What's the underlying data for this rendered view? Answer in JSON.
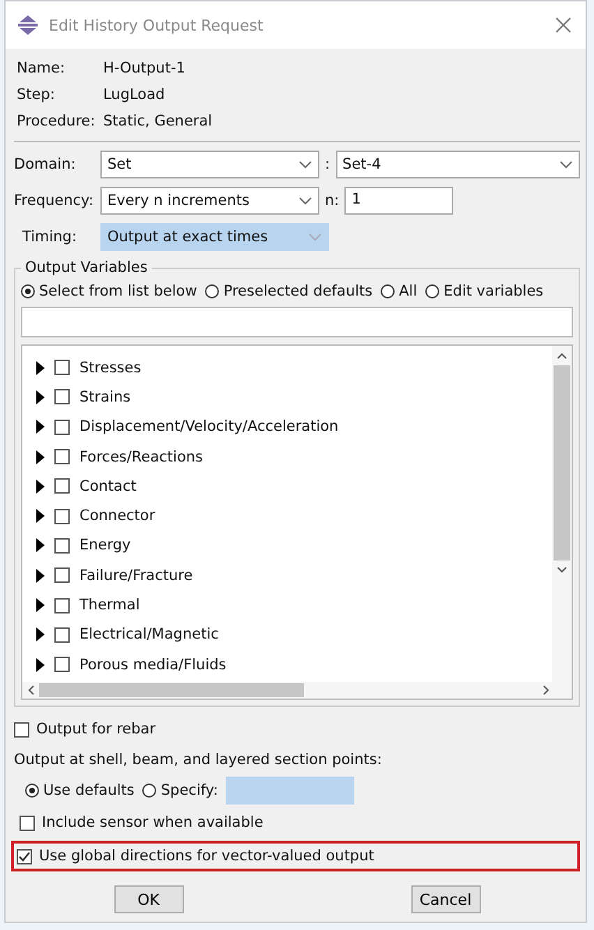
{
  "window": {
    "title": "Edit History Output Request"
  },
  "info": [
    {
      "label": "Name:",
      "value": "H-Output-1"
    },
    {
      "label": "Step:",
      "value": "LugLoad"
    },
    {
      "label": "Procedure:",
      "value": "Static, General"
    }
  ],
  "domain": {
    "label": "Domain:",
    "value": "Set",
    "separator": ":",
    "set": "Set-4"
  },
  "frequency": {
    "label": "Frequency:",
    "value": "Every n increments",
    "n_label": "n:",
    "n": "1"
  },
  "timing": {
    "label": "Timing:",
    "value": "Output at exact times"
  },
  "output_variables": {
    "title": "Output Variables",
    "modes": [
      {
        "label": "Select from list below",
        "selected": true
      },
      {
        "label": "Preselected defaults",
        "selected": false
      },
      {
        "label": "All",
        "selected": false
      },
      {
        "label": "Edit variables",
        "selected": false
      }
    ],
    "tree": [
      {
        "label": "Stresses",
        "checked": false
      },
      {
        "label": "Strains",
        "checked": false
      },
      {
        "label": "Displacement/Velocity/Acceleration",
        "checked": false
      },
      {
        "label": "Forces/Reactions",
        "checked": false
      },
      {
        "label": "Contact",
        "checked": false
      },
      {
        "label": "Connector",
        "checked": false
      },
      {
        "label": "Energy",
        "checked": false
      },
      {
        "label": "Failure/Fracture",
        "checked": false
      },
      {
        "label": "Thermal",
        "checked": false
      },
      {
        "label": "Electrical/Magnetic",
        "checked": false
      },
      {
        "label": "Porous media/Fluids",
        "checked": false
      }
    ]
  },
  "rebar": {
    "label": "Output for rebar",
    "checked": false
  },
  "section_points": {
    "label": "Output at shell, beam, and layered section points:",
    "options": [
      {
        "label": "Use defaults",
        "selected": true
      },
      {
        "label": "Specify:",
        "selected": false
      }
    ]
  },
  "options": [
    {
      "label": "Include sensor when available",
      "checked": false,
      "highlighted": false
    },
    {
      "label": "Use global directions for vector-valued output",
      "checked": true,
      "highlighted": true
    }
  ],
  "buttons": [
    "OK",
    "Cancel"
  ]
}
